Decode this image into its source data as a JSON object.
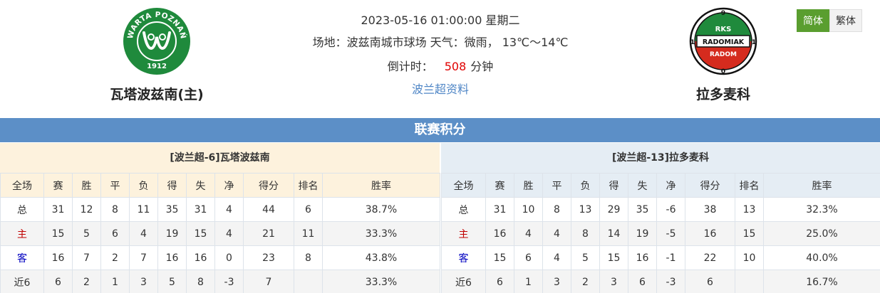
{
  "match": {
    "datetime": "2023-05-16 01:00:00 星期二",
    "venue_weather": "场地：波兹南城市球场 天气：微雨， 13℃～14℃",
    "countdown_label": "倒计时：",
    "countdown_value": "508",
    "countdown_unit": "分钟",
    "league_link": "波兰超资料"
  },
  "home_team": {
    "name": "瓦塔波兹南(主)",
    "logo_text_top": "WARTA POZNAŃ",
    "logo_year": "1912",
    "logo_color": "#1f8a3c"
  },
  "away_team": {
    "name": "拉多麦科",
    "logo_top": "9",
    "logo_bottom": "0",
    "logo_left": "1",
    "logo_right": "1",
    "logo_line1": "RKS",
    "logo_line2": "RADOMIAK",
    "logo_line3": "RADOM",
    "logo_colors": {
      "green": "#1f8a3c",
      "red": "#d52b1e"
    }
  },
  "lang": {
    "simplified": "简体",
    "traditional": "繁体"
  },
  "standings": {
    "title": "联赛积分",
    "columns": [
      "全场",
      "赛",
      "胜",
      "平",
      "负",
      "得",
      "失",
      "净",
      "得分",
      "排名",
      "胜率"
    ],
    "home": {
      "title": "[波兰超-6]瓦塔波兹南",
      "rows": [
        [
          "总",
          "31",
          "12",
          "8",
          "11",
          "35",
          "31",
          "4",
          "44",
          "6",
          "38.7%"
        ],
        [
          "主",
          "15",
          "5",
          "6",
          "4",
          "19",
          "15",
          "4",
          "21",
          "11",
          "33.3%"
        ],
        [
          "客",
          "16",
          "7",
          "2",
          "7",
          "16",
          "16",
          "0",
          "23",
          "8",
          "43.8%"
        ],
        [
          "近6",
          "6",
          "2",
          "1",
          "3",
          "5",
          "8",
          "-3",
          "7",
          "",
          "33.3%"
        ]
      ]
    },
    "away": {
      "title": "[波兰超-13]拉多麦科",
      "rows": [
        [
          "总",
          "31",
          "10",
          "8",
          "13",
          "29",
          "35",
          "-6",
          "38",
          "13",
          "32.3%"
        ],
        [
          "主",
          "16",
          "4",
          "4",
          "8",
          "14",
          "19",
          "-5",
          "16",
          "15",
          "25.0%"
        ],
        [
          "客",
          "15",
          "6",
          "4",
          "5",
          "15",
          "16",
          "-1",
          "22",
          "10",
          "40.0%"
        ],
        [
          "近6",
          "6",
          "1",
          "3",
          "2",
          "3",
          "6",
          "-3",
          "6",
          "",
          "16.7%"
        ]
      ]
    }
  }
}
